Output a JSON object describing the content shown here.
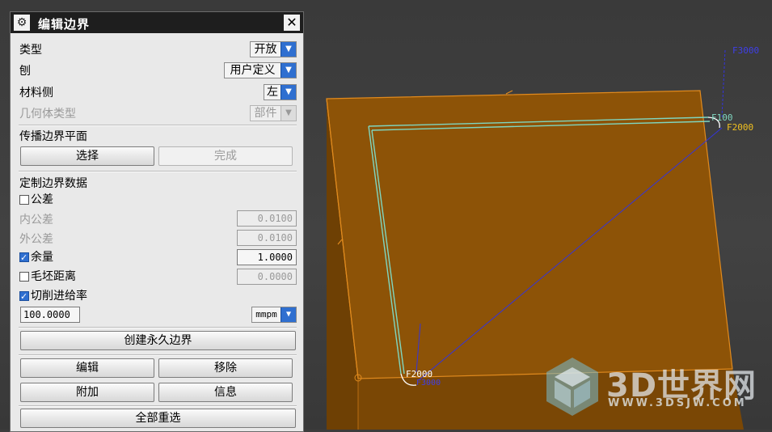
{
  "dialog": {
    "title": "编辑边界",
    "settings_icon": "gear-icon",
    "close_label": "✕",
    "type_label": "类型",
    "type_value": "开放",
    "plane_label": "刨",
    "plane_value": "用户定义",
    "material_side_label": "材料侧",
    "material_side_value": "左",
    "geometry_type_label": "几何体类型",
    "geometry_type_value": "部件",
    "propagate_label": "传播边界平面",
    "select_button": "选择",
    "done_button": "完成",
    "custom_label": "定制边界数据",
    "tolerance_label": "公差",
    "tolerance_checked": false,
    "intol_label": "内公差",
    "intol_value": "0.0100",
    "outtol_label": "外公差",
    "outtol_value": "0.0100",
    "stock_label": "余量",
    "stock_checked": true,
    "stock_value": "1.0000",
    "blank_distance_label": "毛坯距离",
    "blank_distance_checked": false,
    "blank_distance_value": "0.0000",
    "feedrate_label": "切削进给率",
    "feedrate_checked": true,
    "feedrate_value": "100.0000",
    "feedrate_unit": "mmpm",
    "create_permanent_button": "创建永久边界",
    "edit_button": "编辑",
    "remove_button": "移除",
    "append_button": "附加",
    "info_button": "信息",
    "reselect_all_button": "全部重选"
  },
  "viewport": {
    "labels": {
      "f3000": "F3000",
      "f100": "F100",
      "f2000_top": "F2000",
      "f2000_bottom": "F2000",
      "f3000_bottom": "F3000"
    },
    "colors": {
      "part": "#8b5206",
      "part_dark": "#6e4004",
      "edge": "#e08a1e",
      "path": "#7fd6c0",
      "motion": "#3333dd"
    }
  },
  "watermark": {
    "brand": "3D世界网",
    "url": "WWW.3DSJW.COM"
  }
}
